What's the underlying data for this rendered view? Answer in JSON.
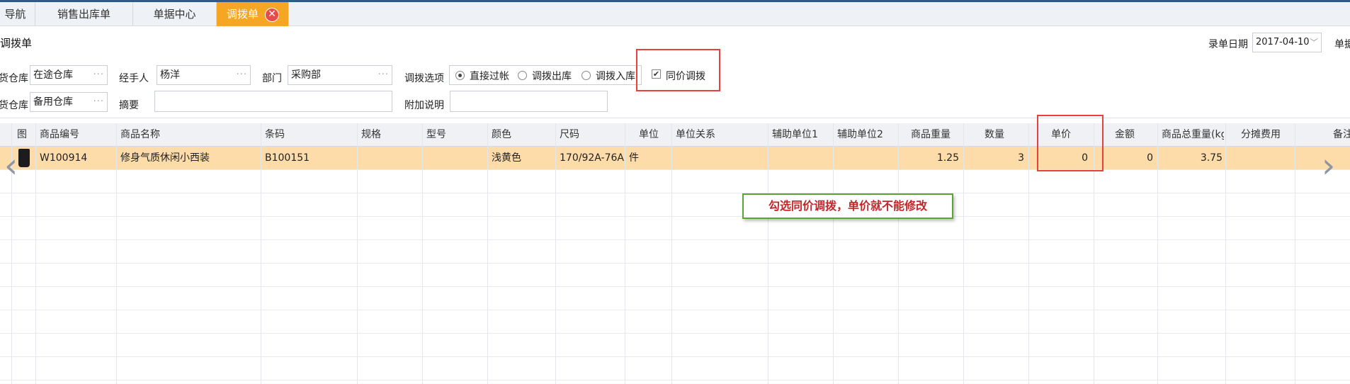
{
  "tabs": [
    {
      "label": "导航",
      "active": false
    },
    {
      "label": "销售出库单",
      "active": false
    },
    {
      "label": "单据中心",
      "active": false
    },
    {
      "label": "调拨单",
      "active": true
    }
  ],
  "form": {
    "title": "调拨单",
    "record_date_label": "录单日期",
    "record_date_value": "2017-04-10",
    "doc_no_label": "单据",
    "out_warehouse_label": "货仓库",
    "out_warehouse_value": "在途仓库",
    "in_warehouse_label": "货仓库",
    "in_warehouse_value": "备用仓库",
    "handler_label": "经手人",
    "handler_value": "杨洋",
    "dept_label": "部门",
    "dept_value": "采购部",
    "summary_label": "摘要",
    "summary_value": "",
    "options_label": "调拨选项",
    "options": [
      "直接过帐",
      "调拨出库",
      "调拨入库"
    ],
    "selected_option": "直接过帐",
    "same_price_label": "同价调拨",
    "same_price_checked": true,
    "extra_note_label": "附加说明",
    "extra_note_value": ""
  },
  "grid": {
    "columns": [
      "图",
      "商品编号",
      "商品名称",
      "条码",
      "规格",
      "型号",
      "颜色",
      "尺码",
      "单位",
      "单位关系",
      "辅助单位1",
      "辅助单位2",
      "商品重量",
      "数量",
      "单价",
      "金额",
      "商品总重量(kg",
      "分摊费用",
      "备注"
    ],
    "rows": [
      {
        "code": "W100914",
        "name": "修身气质休闲小西装",
        "barcode": "B100151",
        "spec": "",
        "model": "",
        "color": "浅黄色",
        "size": "170/92A-76A",
        "unit": "件",
        "unit_relation": "",
        "aux_unit1": "",
        "aux_unit2": "",
        "weight": "1.25",
        "qty": "3",
        "price": "0",
        "amount": "0",
        "total_weight": "3.75",
        "alloc_fee": ""
      }
    ]
  },
  "annotation": {
    "text": "勾选同价调拨，单价就不能修改",
    "highlight_color": "#e8403c",
    "callout_border_color": "#5aa532",
    "callout_text_color": "#c0282b"
  },
  "colors": {
    "active_tab": "#f5a623",
    "selected_row": "#fddcaa",
    "close_icon": "#e94b4b"
  },
  "icons": {
    "tab_close": "close-icon",
    "nav_prev": "chevron-left-icon",
    "nav_next": "chevron-right-icon",
    "field_browse": "ellipsis-icon",
    "date_dropdown": "chevron-down-icon"
  }
}
